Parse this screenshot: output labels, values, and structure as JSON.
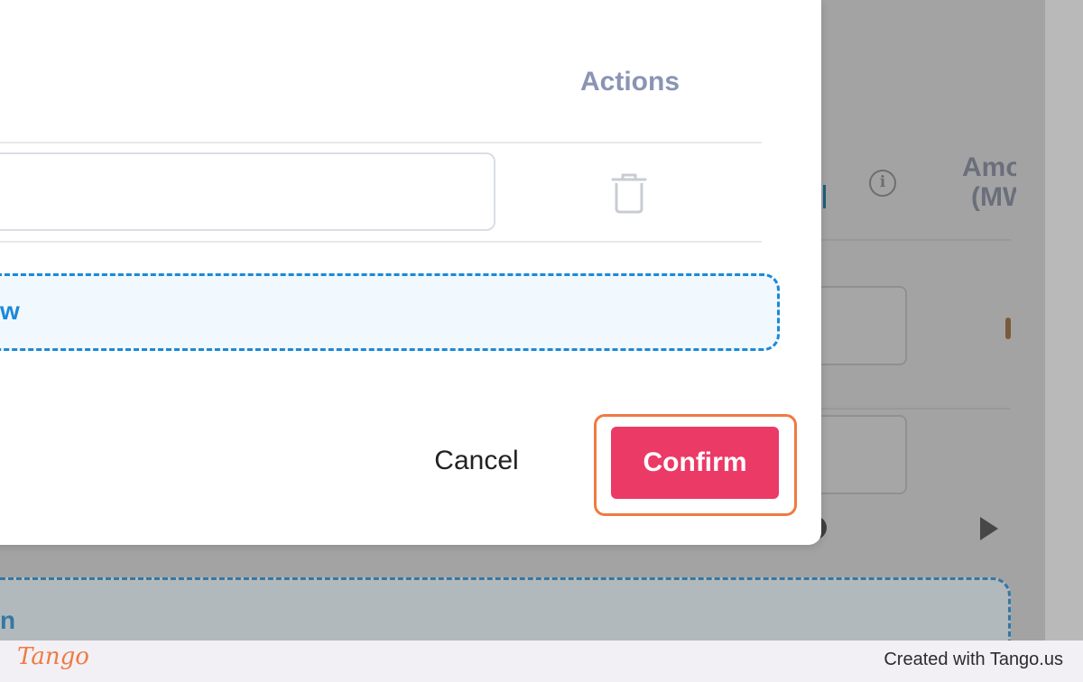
{
  "background": {
    "amount_header_line1": "Amo",
    "amount_header_line2": "(MW",
    "info_icon_glyph": "i",
    "add_link_fragment": "n"
  },
  "modal": {
    "actions_header": "Actions",
    "text_input_value": "",
    "add_row_label_fragment": "w",
    "cancel_label": "Cancel",
    "confirm_label": "Confirm"
  },
  "footer": {
    "logo_text": "Tango",
    "created_with": "Created with Tango.us"
  },
  "colors": {
    "confirm_bg": "#ec3a67",
    "highlight": "#f07a43",
    "add_row_border": "#1c88d8",
    "actions_header": "#8a94b3"
  },
  "icons": [
    "trash-icon",
    "info-icon",
    "play-icon"
  ]
}
